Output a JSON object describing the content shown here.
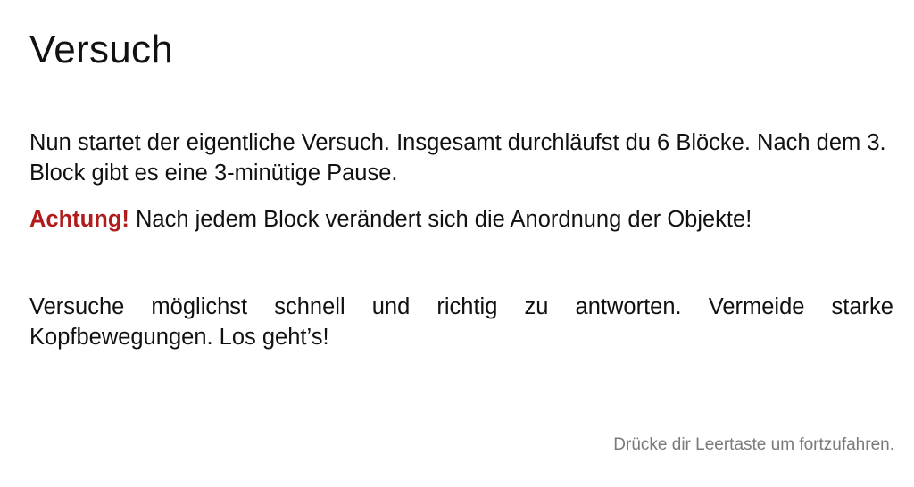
{
  "slide": {
    "title": "Versuch",
    "intro": "Nun startet der eigentliche Versuch. Insgesamt durchläufst du 6 Blöcke. Nach dem 3. Block gibt es eine 3-minütige Pause.",
    "warning_label": "Achtung!",
    "warning_text": " Nach jedem Block verändert sich die Anordnung der Objekte!",
    "instructions": "Versuche möglichst schnell und richtig zu antworten. Vermeide starke Kopfbewegungen. Los geht’s!",
    "footer_hint": "Drücke dir Leertaste um fortzufahren."
  },
  "colors": {
    "warning": "#b01c1c",
    "hint": "#7a7a7a",
    "text": "#111111",
    "background": "#ffffff"
  }
}
